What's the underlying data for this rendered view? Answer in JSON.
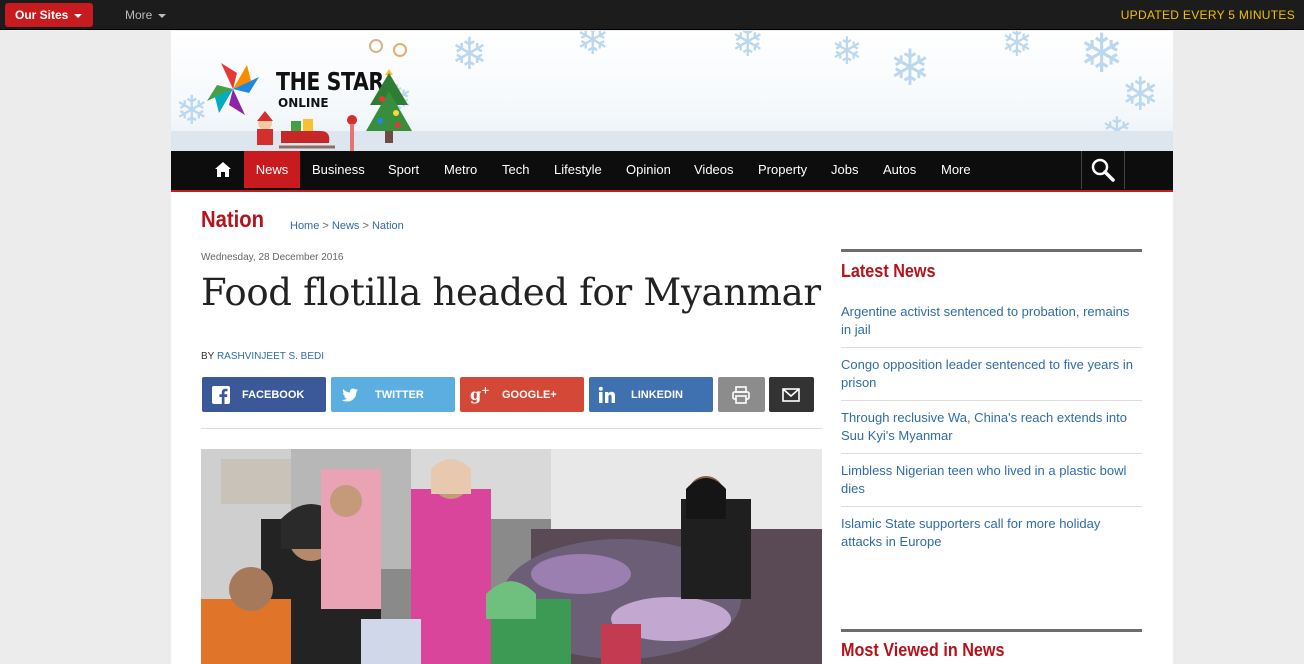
{
  "topbar": {
    "our_sites": "Our Sites",
    "more": "More",
    "updated": "UPDATED EVERY 5 MINUTES"
  },
  "logo": {
    "line1": "THE STAR",
    "line2": "ONLINE"
  },
  "nav": {
    "items": [
      "News",
      "Business",
      "Sport",
      "Metro",
      "Tech",
      "Lifestyle",
      "Opinion",
      "Videos",
      "Property",
      "Jobs",
      "Autos",
      "More"
    ],
    "active": "News"
  },
  "section": {
    "title": "Nation",
    "breadcrumb": [
      "Home",
      "News",
      "Nation"
    ],
    "breadcrumb_sep": ">"
  },
  "article": {
    "date": "Wednesday, 28 December 2016",
    "headline": "Food flotilla headed for Myanmar",
    "by_prefix": "BY",
    "author": "RASHVINJEET S. BEDI"
  },
  "share": {
    "facebook": "FACEBOOK",
    "twitter": "TWITTER",
    "googleplus": "GOOGLE+",
    "linkedin": "LINKEDIN",
    "colors": {
      "facebook": "#3b5998",
      "twitter": "#5bafe0",
      "googleplus": "#d34836",
      "linkedin": "#3f71b0",
      "print": "#8c8c8c",
      "email": "#333333"
    }
  },
  "sidebar": {
    "latest_title": "Latest News",
    "latest_items": [
      "Argentine activist sentenced to probation, remains in jail",
      "Congo opposition leader sentenced to five years in prison",
      "Through reclusive Wa, China's reach extends into Suu Kyi's Myanmar",
      "Limbless Nigerian teen who lived in a plastic bowl dies",
      "Islamic State supporters call for more holiday attacks in Europe"
    ],
    "most_viewed_title": "Most Viewed in News"
  },
  "colors": {
    "brand_red": "#c81b1f",
    "link_blue": "#2f6ca6",
    "accent_yellow": "#f0c000"
  }
}
